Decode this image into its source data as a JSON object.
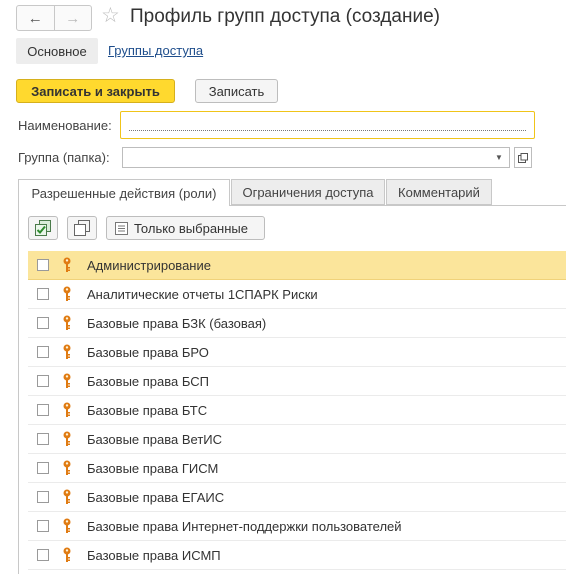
{
  "title": "Профиль групп доступа (создание)",
  "navigation": {
    "back_icon": "←",
    "forward_icon": "→",
    "star_icon": "☆"
  },
  "sections": {
    "main_label": "Основное",
    "link_label": "Группы доступа"
  },
  "commands": {
    "save_close_label": "Записать и закрыть",
    "save_label": "Записать"
  },
  "form": {
    "name_label": "Наименование:",
    "name_value": "",
    "group_label": "Группа (папка):",
    "group_value": ""
  },
  "tabs": [
    {
      "label": "Разрешенные действия (роли)",
      "active": true
    },
    {
      "label": "Ограничения доступа",
      "active": false
    },
    {
      "label": "Комментарий",
      "active": false
    }
  ],
  "toolbar": {
    "only_selected_label": "Только выбранные"
  },
  "roles": [
    {
      "label": "Администрирование",
      "checked": false,
      "selected": true
    },
    {
      "label": "Аналитические отчеты 1СПАРК Риски",
      "checked": false,
      "selected": false
    },
    {
      "label": "Базовые права БЗК (базовая)",
      "checked": false,
      "selected": false
    },
    {
      "label": "Базовые права БРО",
      "checked": false,
      "selected": false
    },
    {
      "label": "Базовые права БСП",
      "checked": false,
      "selected": false
    },
    {
      "label": "Базовые права БТС",
      "checked": false,
      "selected": false
    },
    {
      "label": "Базовые права ВетИС",
      "checked": false,
      "selected": false
    },
    {
      "label": "Базовые права ГИСМ",
      "checked": false,
      "selected": false
    },
    {
      "label": "Базовые права ЕГАИС",
      "checked": false,
      "selected": false
    },
    {
      "label": "Базовые права Интернет-поддержки пользователей",
      "checked": false,
      "selected": false
    },
    {
      "label": "Базовые права ИСМП",
      "checked": false,
      "selected": false
    }
  ],
  "colors": {
    "accent": "#ffd92e",
    "selected_row": "#fbe59b",
    "link": "#1f4e8c",
    "key_icon": "#e07b12"
  }
}
